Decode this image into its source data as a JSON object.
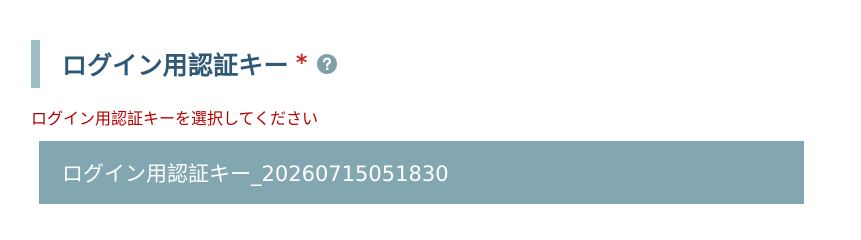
{
  "field": {
    "title": "ログイン用認証キー",
    "required_mark": "*",
    "help_icon": "question-circle-icon",
    "error_message": "ログイン用認証キーを選択してください",
    "selected_value": "ログイン用認証キー_20260715051830"
  },
  "colors": {
    "title": "#2f5876",
    "accent_bar": "#9fbec4",
    "required": "#c62828",
    "error": "#b40000",
    "select_background": "#83a7b0",
    "select_text": "#ffffff",
    "help_icon": "#7f9ea6"
  }
}
